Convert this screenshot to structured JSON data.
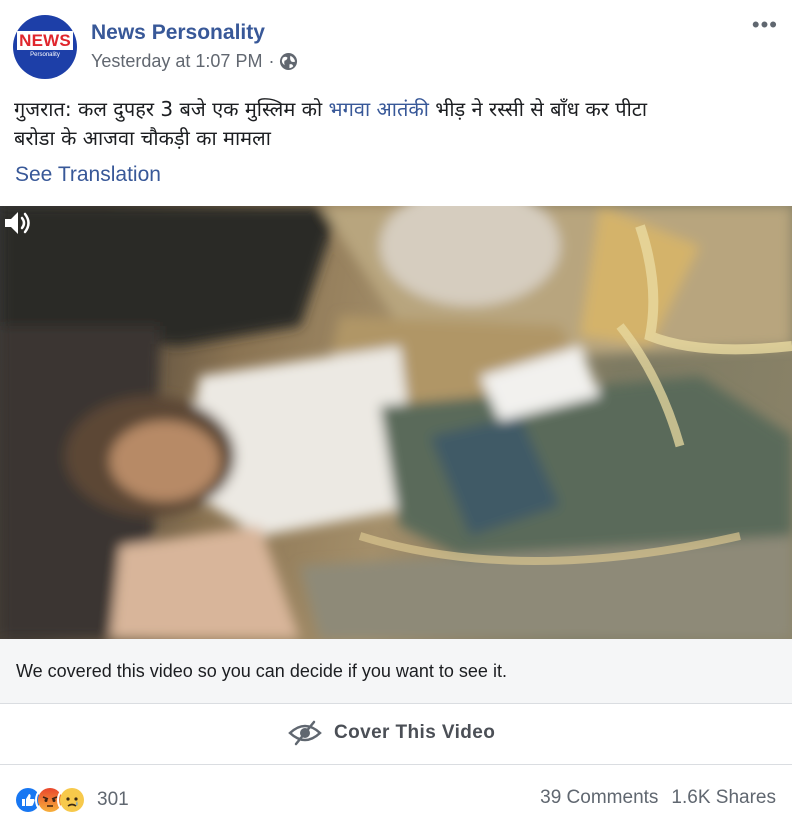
{
  "post": {
    "avatar_text": "NEWS",
    "avatar_subtext": "Personality",
    "page_name": "News Personality",
    "timestamp": "Yesterday at 1:07 PM",
    "separator": "·",
    "privacy_icon": "globe-icon",
    "more_label": "•••",
    "text_line1_before": "गुजरात: कल दुपहर 3 बजे एक मुस्लिम को ",
    "text_line1_link": "भगवा आतंकी",
    "text_line1_after": " भीड़ ने रस्सी से बाँध कर पीटा",
    "text_line2": "बरोडा के आजवा चौकड़ी का मामला",
    "see_translation": "See Translation"
  },
  "video": {
    "volume_icon": "speaker-icon",
    "covered_notice": "We covered this video so you can decide if you want to see it.",
    "cover_button_icon": "eye-slash-icon",
    "cover_button_label": "Cover This Video"
  },
  "footer": {
    "reaction_icons": [
      "like-icon",
      "angry-icon",
      "sad-icon"
    ],
    "reaction_count": "301",
    "comments": "39 Comments",
    "shares": "1.6K Shares"
  },
  "colors": {
    "link": "#385898",
    "secondary_text": "#616770",
    "like_blue": "#1877f2",
    "angry_orange": "#f0663a",
    "sad_yellow": "#f7c94b"
  }
}
